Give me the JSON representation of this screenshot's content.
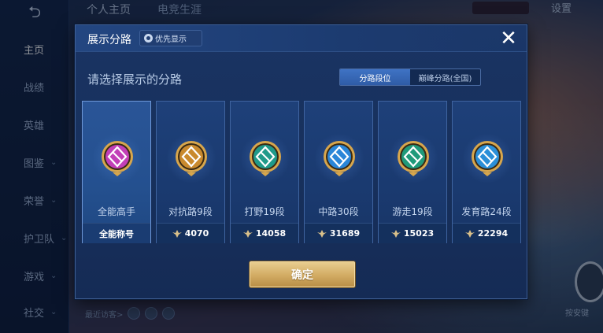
{
  "background": {
    "back_glyph": "⮌",
    "top_tabs": [
      "个人主页",
      "电竞生涯"
    ],
    "settings_label": "设置",
    "sidebar": {
      "items": [
        {
          "label": "主页",
          "active": true,
          "expandable": false
        },
        {
          "label": "战绩",
          "active": false,
          "expandable": false
        },
        {
          "label": "英雄",
          "active": false,
          "expandable": false
        },
        {
          "label": "图鉴",
          "active": false,
          "expandable": true
        },
        {
          "label": "荣誉",
          "active": false,
          "expandable": true
        },
        {
          "label": "护卫队",
          "active": false,
          "expandable": true
        },
        {
          "label": "游戏",
          "active": false,
          "expandable": true
        },
        {
          "label": "社交",
          "active": false,
          "expandable": true
        }
      ]
    },
    "recent_visitors_label": "最近访客>",
    "right_button_label": "按安键"
  },
  "dialog": {
    "title": "展示分路",
    "priority_chip_label": "优先显示",
    "close_glyph": "✕",
    "subtitle": "请选择展示的分路",
    "tabs": [
      {
        "label": "分路段位",
        "active": true
      },
      {
        "label": "巅峰分路(全国)",
        "active": false
      }
    ],
    "lanes": [
      {
        "name": "全能高手",
        "footer": "全能称号",
        "has_score_icon": false,
        "selected": true,
        "emblem_color": "#c23fb8",
        "icon": "all-round-emblem-icon"
      },
      {
        "name": "对抗路9段",
        "footer": "4070",
        "has_score_icon": true,
        "selected": false,
        "emblem_color": "#c98a2e",
        "icon": "clash-lane-emblem-icon"
      },
      {
        "name": "打野19段",
        "footer": "14058",
        "has_score_icon": true,
        "selected": false,
        "emblem_color": "#1f9a8a",
        "icon": "jungle-emblem-icon"
      },
      {
        "name": "中路30段",
        "footer": "31689",
        "has_score_icon": true,
        "selected": false,
        "emblem_color": "#2a86d8",
        "icon": "mid-lane-emblem-icon"
      },
      {
        "name": "游走19段",
        "footer": "15023",
        "has_score_icon": true,
        "selected": false,
        "emblem_color": "#1f9a7a",
        "icon": "roam-emblem-icon"
      },
      {
        "name": "发育路24段",
        "footer": "22294",
        "has_score_icon": true,
        "selected": false,
        "emblem_color": "#2b8fd8",
        "icon": "farm-lane-emblem-icon"
      }
    ],
    "confirm_label": "确定",
    "colors": {
      "gold_ring": "#d7a64c",
      "confirm_gold": "#d2ab63",
      "accent_blue": "#3f73c4"
    }
  }
}
